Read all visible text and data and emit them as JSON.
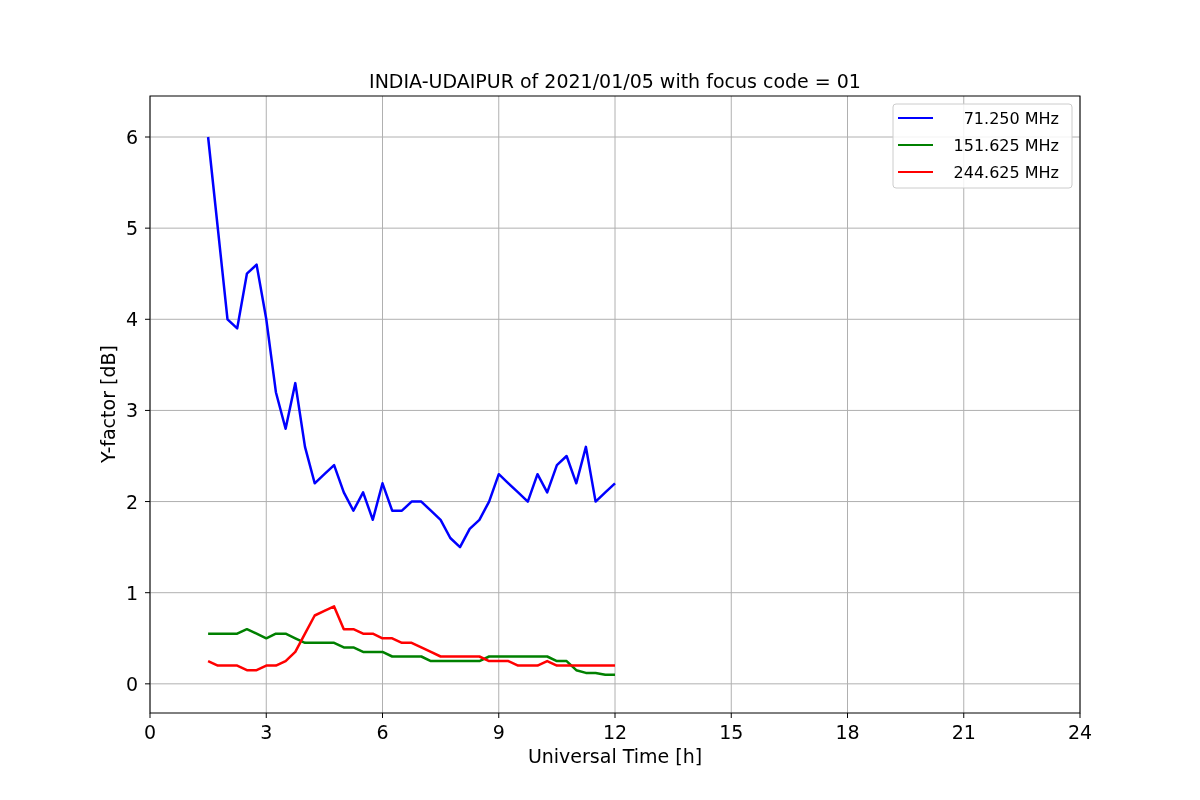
{
  "chart_data": {
    "type": "line",
    "title": "INDIA-UDAIPUR of 2021/01/05 with focus code = 01",
    "xlabel": "Universal Time [h]",
    "ylabel": "Y-factor [dB]",
    "x": [
      1.5,
      1.75,
      2,
      2.25,
      2.5,
      2.75,
      3,
      3.25,
      3.5,
      3.75,
      4,
      4.25,
      4.5,
      4.75,
      5,
      5.25,
      5.5,
      5.75,
      6,
      6.25,
      6.5,
      6.75,
      7,
      7.25,
      7.5,
      7.75,
      8,
      8.25,
      8.5,
      8.75,
      9,
      9.25,
      9.5,
      9.75,
      10,
      10.25,
      10.5,
      10.75,
      11,
      11.25,
      11.5,
      11.75,
      12
    ],
    "series": [
      {
        "name": " 71.250 MHz",
        "color": "#0000ff",
        "values": [
          6.0,
          5.0,
          4.0,
          3.9,
          4.5,
          4.6,
          4.0,
          3.2,
          2.8,
          3.3,
          2.6,
          2.2,
          2.3,
          2.4,
          2.1,
          1.9,
          2.1,
          1.8,
          2.2,
          1.9,
          1.9,
          2.0,
          2.0,
          1.9,
          1.8,
          1.6,
          1.5,
          1.7,
          1.8,
          2.0,
          2.3,
          2.2,
          2.1,
          2.0,
          2.3,
          2.1,
          2.4,
          2.5,
          2.2,
          2.6,
          2.0,
          2.1,
          2.2
        ]
      },
      {
        "name": "151.625 MHz",
        "color": "#008000",
        "values": [
          0.55,
          0.55,
          0.55,
          0.55,
          0.6,
          0.55,
          0.5,
          0.55,
          0.55,
          0.5,
          0.45,
          0.45,
          0.45,
          0.45,
          0.4,
          0.4,
          0.35,
          0.35,
          0.35,
          0.3,
          0.3,
          0.3,
          0.3,
          0.25,
          0.25,
          0.25,
          0.25,
          0.25,
          0.25,
          0.3,
          0.3,
          0.3,
          0.3,
          0.3,
          0.3,
          0.3,
          0.25,
          0.25,
          0.15,
          0.12,
          0.12,
          0.1,
          0.1
        ]
      },
      {
        "name": "244.625 MHz",
        "color": "#ff0000",
        "values": [
          0.25,
          0.2,
          0.2,
          0.2,
          0.15,
          0.15,
          0.2,
          0.2,
          0.25,
          0.35,
          0.55,
          0.75,
          0.8,
          0.85,
          0.6,
          0.6,
          0.55,
          0.55,
          0.5,
          0.5,
          0.45,
          0.45,
          0.4,
          0.35,
          0.3,
          0.3,
          0.3,
          0.3,
          0.3,
          0.25,
          0.25,
          0.25,
          0.2,
          0.2,
          0.2,
          0.25,
          0.2,
          0.2,
          0.2,
          0.2,
          0.2,
          0.2,
          0.2
        ]
      }
    ],
    "grid": true,
    "legend": true,
    "xlim": [
      0,
      24
    ],
    "ylim": [
      -0.32,
      6.45
    ],
    "xticks": [
      0,
      3,
      6,
      9,
      12,
      15,
      18,
      21,
      24
    ],
    "yticks": [
      0,
      1,
      2,
      3,
      4,
      5,
      6
    ]
  }
}
